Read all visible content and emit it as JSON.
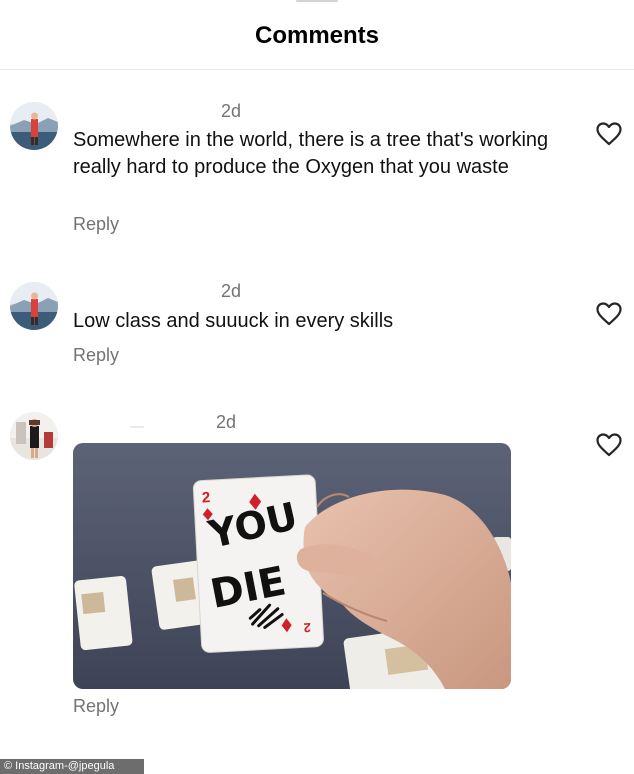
{
  "header": {
    "title": "Comments"
  },
  "comments": [
    {
      "time": "2d",
      "text": "Somewhere in the world, there is a tree that's working really hard to produce the Oxygen that you waste",
      "reply_label": "Reply"
    },
    {
      "time": "2d",
      "text": "Low class and suuuck in every skills",
      "reply_label": "Reply"
    },
    {
      "time": "2d",
      "image_card_text": [
        "YOU",
        "DIE"
      ],
      "image_card_rank": "2",
      "reply_label": "Reply"
    }
  ],
  "watermark": "© Instagram-@jpegula",
  "icons": [
    "avatar",
    "heart-icon"
  ],
  "colors": {
    "secondary_text": "#737373",
    "card_suit": "#d0202a"
  }
}
